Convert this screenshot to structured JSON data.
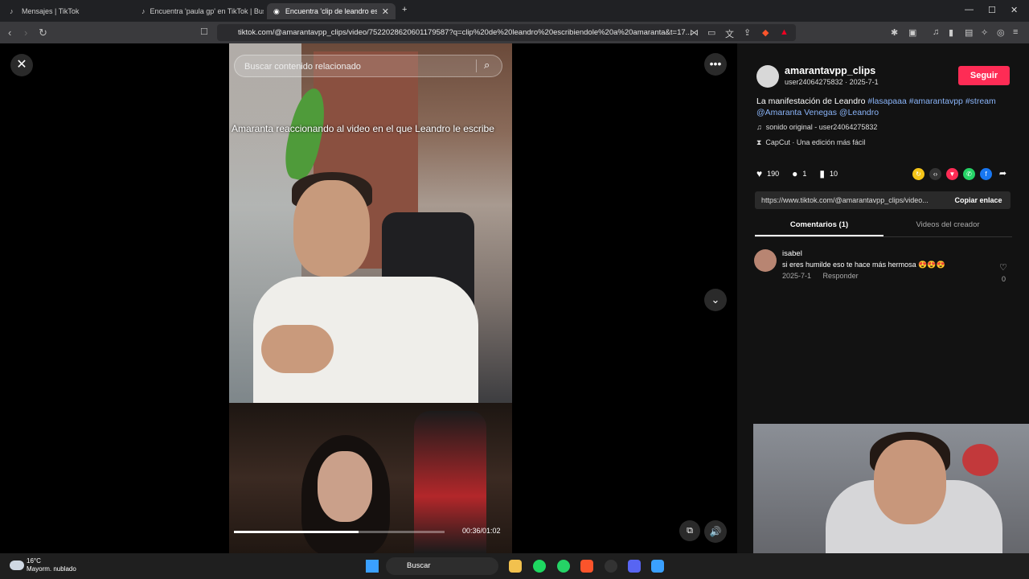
{
  "browser": {
    "tabs": [
      {
        "label": "Mensajes | TikTok"
      },
      {
        "label": "Encuentra 'paula gp' en TikTok | Bus"
      },
      {
        "label": "Encuentra 'clip de leandro es"
      }
    ],
    "url": "tiktok.com/@amarantavpp_clips/video/7522028620601179587?q=clip%20de%20leandro%20escribiendole%20a%20amaranta&t=17..."
  },
  "video": {
    "search_placeholder": "Buscar contenido relacionado",
    "caption": "Amaranta reaccionando al video en el que Leandro le escribe",
    "time": "00:36/01:02",
    "progress": 0.59
  },
  "panel": {
    "username": "amarantavpp_clips",
    "meta": "user24064275832 · 2025-7-1",
    "follow_label": "Seguir",
    "desc_text": "La manifestación de Leandro",
    "desc_tags": [
      "#lasapaaa",
      "#amarantavpp",
      "#stream",
      "@Amaranta Venegas",
      "@Leandro"
    ],
    "sound": "sonido original - user24064275832",
    "capcut": "CapCut · Una edición más fácil",
    "likes": "190",
    "comments": "1",
    "saves": "10",
    "link": "https://www.tiktok.com/@amarantavpp_clips/video...",
    "copy_label": "Copiar enlace",
    "tab_comments": "Comentarios (1)",
    "tab_creator": "Videos del creador"
  },
  "comment": {
    "user": "isabel",
    "text": "si eres humilde eso te hace más hermosa 😍😍😍",
    "date": "2025-7-1",
    "reply": "Responder",
    "likes": "0"
  },
  "taskbar": {
    "temp": "16°C",
    "weather": "Mayorm. nublado",
    "search": "Buscar"
  },
  "colors": {
    "follow": "#fe2c55",
    "tag": "#8ab4f8"
  }
}
